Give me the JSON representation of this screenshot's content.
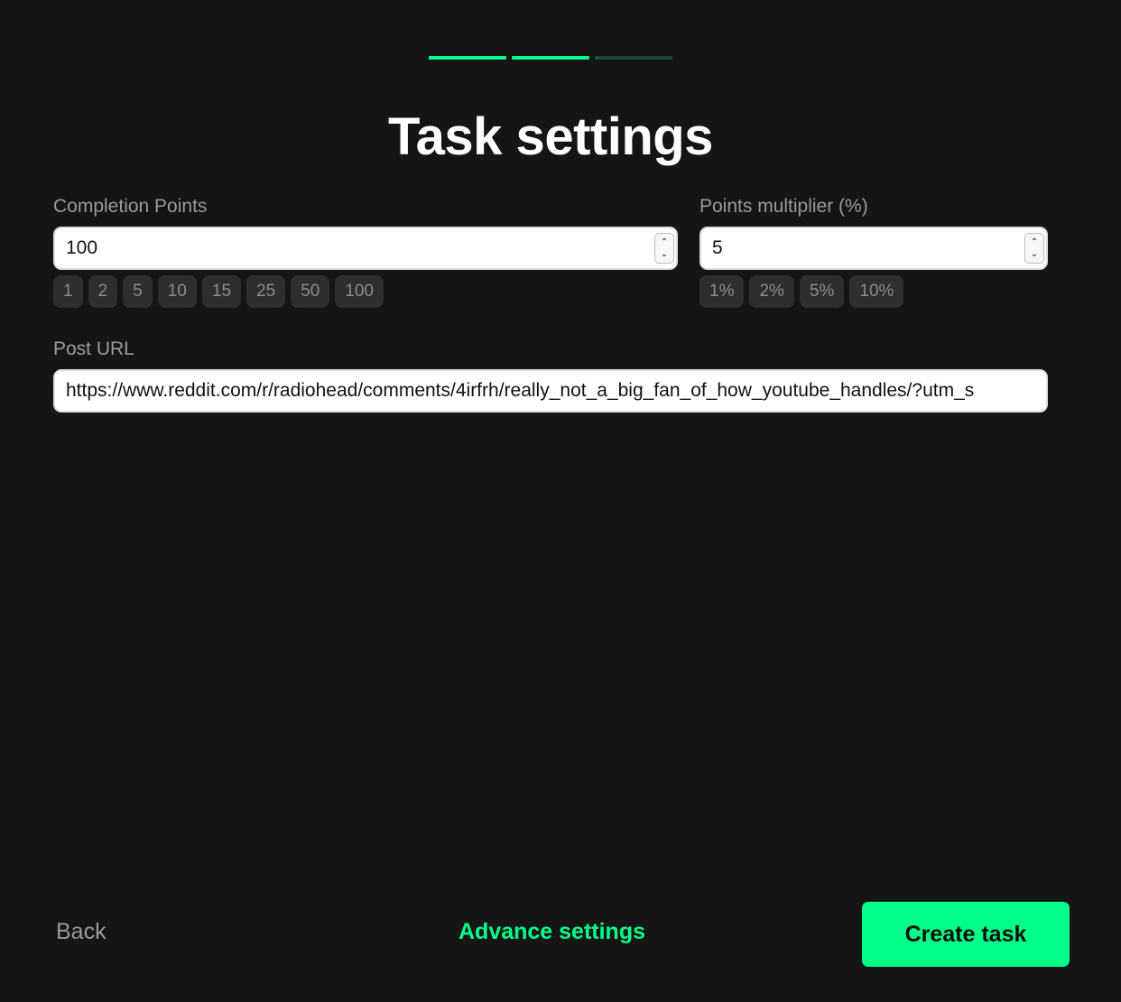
{
  "progress": {
    "steps_total": 3,
    "steps_completed": 2,
    "accent_color": "#00ff88",
    "inactive_color": "#1d4a2f"
  },
  "header": {
    "title": "Task settings"
  },
  "completion_points": {
    "label": "Completion Points",
    "value": "100",
    "presets": [
      "1",
      "2",
      "5",
      "10",
      "15",
      "25",
      "50",
      "100"
    ]
  },
  "points_multiplier": {
    "label": "Points multiplier (%)",
    "value": "5",
    "presets": [
      "1%",
      "2%",
      "5%",
      "10%"
    ]
  },
  "post_url": {
    "label": "Post URL",
    "value": "https://www.reddit.com/r/radiohead/comments/4irfrh/really_not_a_big_fan_of_how_youtube_handles/?utm_s"
  },
  "footer": {
    "back_label": "Back",
    "advance_label": "Advance settings",
    "create_label": "Create task"
  },
  "icons": {
    "stepper_up": "chevron-up-icon",
    "stepper_down": "chevron-down-icon"
  }
}
